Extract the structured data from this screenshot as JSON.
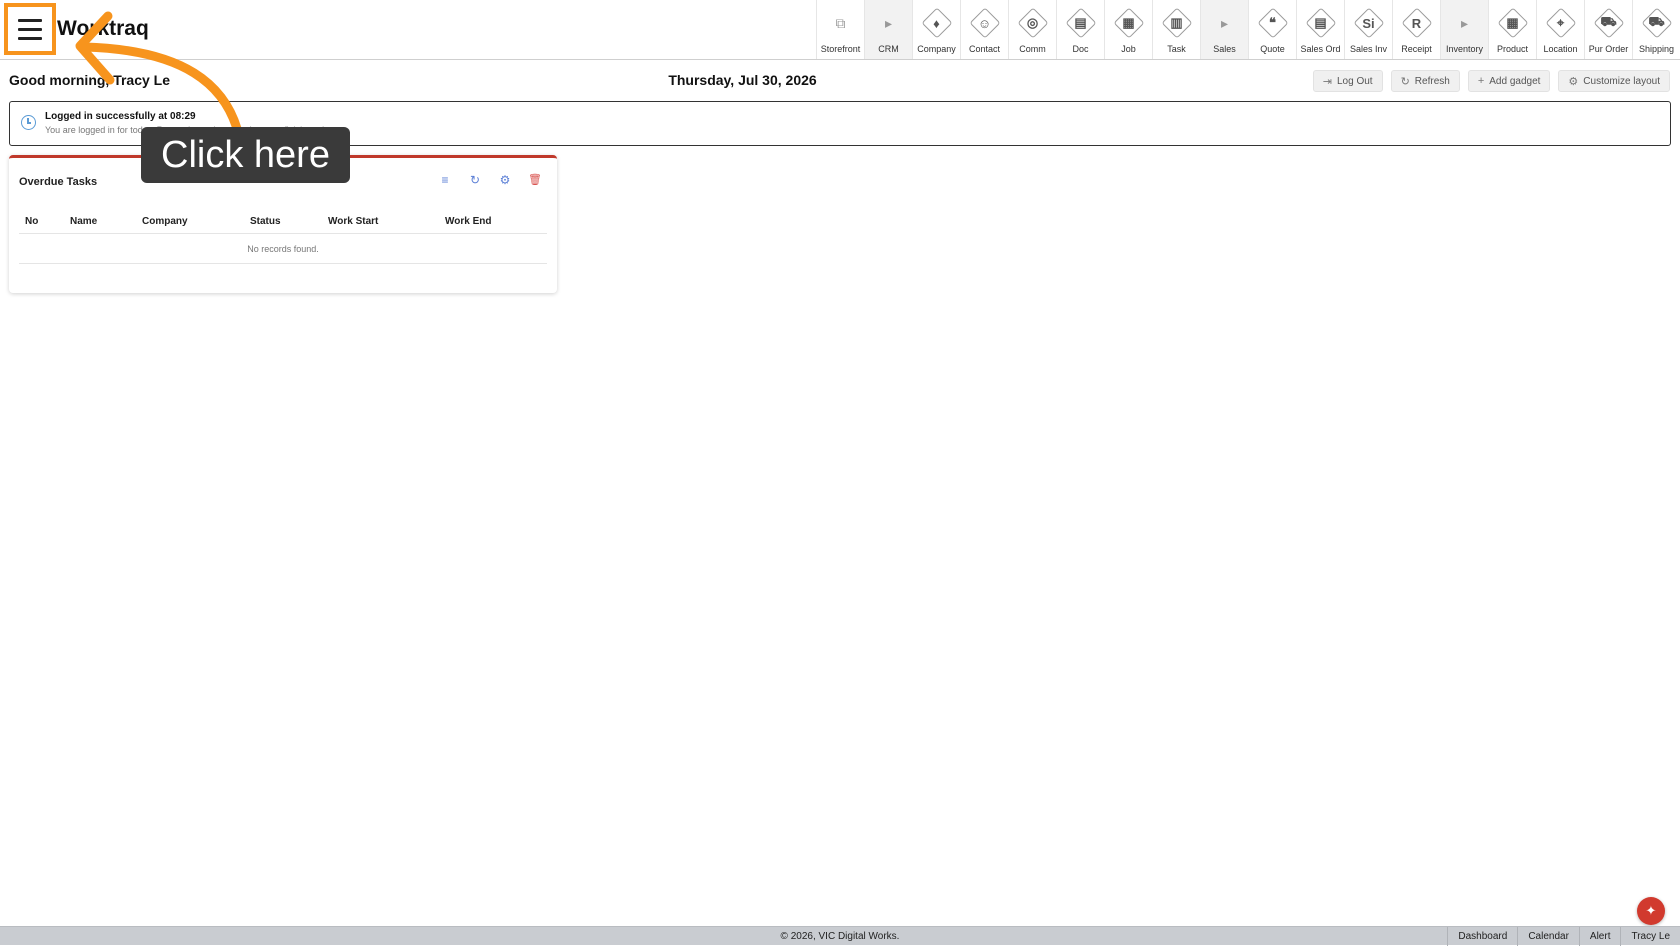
{
  "app": {
    "brand": "Worktraq"
  },
  "modules": [
    {
      "label": "Storefront",
      "icon": "external-link-icon",
      "glyph": "⧉",
      "sep": false
    },
    {
      "label": "CRM",
      "icon": "caret-right-icon",
      "glyph": "▸",
      "sep": true
    },
    {
      "label": "Company",
      "icon": "company-icon",
      "glyph": "♦",
      "sep": false
    },
    {
      "label": "Contact",
      "icon": "contact-icon",
      "glyph": "☺",
      "sep": false
    },
    {
      "label": "Comm",
      "icon": "comm-icon",
      "glyph": "◎",
      "sep": false
    },
    {
      "label": "Doc",
      "icon": "doc-icon",
      "glyph": "▤",
      "sep": false
    },
    {
      "label": "Job",
      "icon": "job-icon",
      "glyph": "▦",
      "sep": false
    },
    {
      "label": "Task",
      "icon": "task-icon",
      "glyph": "▥",
      "sep": false
    },
    {
      "label": "Sales",
      "icon": "caret-right-icon",
      "glyph": "▸",
      "sep": true
    },
    {
      "label": "Quote",
      "icon": "quote-icon",
      "glyph": "❝",
      "sep": false
    },
    {
      "label": "Sales Ord",
      "icon": "sales-order-icon",
      "glyph": "▤",
      "sep": false
    },
    {
      "label": "Sales Inv",
      "icon": "sales-invoice-icon",
      "glyph": "Si",
      "sep": false
    },
    {
      "label": "Receipt",
      "icon": "receipt-icon",
      "glyph": "R",
      "sep": false
    },
    {
      "label": "Inventory",
      "icon": "caret-right-icon",
      "glyph": "▸",
      "sep": true
    },
    {
      "label": "Product",
      "icon": "product-icon",
      "glyph": "▦",
      "sep": false
    },
    {
      "label": "Location",
      "icon": "location-icon",
      "glyph": "⌖",
      "sep": false
    },
    {
      "label": "Pur Order",
      "icon": "cart-icon",
      "glyph": "⛟",
      "sep": false
    },
    {
      "label": "Shipping",
      "icon": "truck-icon",
      "glyph": "⛟",
      "sep": false
    }
  ],
  "header": {
    "greeting": "Good morning, Tracy Le",
    "date": "Thursday, Jul 30, 2026",
    "actions": [
      {
        "label": "Log Out",
        "icon": "logout-icon",
        "glyph": "⇥"
      },
      {
        "label": "Refresh",
        "icon": "refresh-icon",
        "glyph": "↻"
      },
      {
        "label": "Add gadget",
        "icon": "plus-icon",
        "glyph": "+"
      },
      {
        "label": "Customize layout",
        "icon": "gear-icon",
        "glyph": "⚙"
      }
    ]
  },
  "notice": {
    "title": "Logged in successfully at 08:29",
    "body": "You are logged in for today. Remember to log out when you finish work."
  },
  "gadget": {
    "title": "Overdue Tasks",
    "tools": [
      {
        "icon": "list-icon",
        "glyph": "≡",
        "color": "#5b7fd6"
      },
      {
        "icon": "refresh-icon",
        "glyph": "↻",
        "color": "#5b7fd6"
      },
      {
        "icon": "gear-icon",
        "glyph": "⚙",
        "color": "#5b7fd6"
      },
      {
        "icon": "trash-icon",
        "glyph": "🗑",
        "color": "#d9534f"
      }
    ],
    "columns": [
      "No",
      "Name",
      "Company",
      "Status",
      "Work Start",
      "Work End"
    ],
    "empty_text": "No records found."
  },
  "tooltip": {
    "text": "Click here"
  },
  "footer": {
    "copyright": "© 2026, VIC Digital Works.",
    "links": [
      "Dashboard",
      "Calendar",
      "Alert",
      "Tracy Le"
    ]
  },
  "colors": {
    "highlight": "#f7941d",
    "accent_red": "#c0392b",
    "tool_blue": "#5b7fd6"
  }
}
